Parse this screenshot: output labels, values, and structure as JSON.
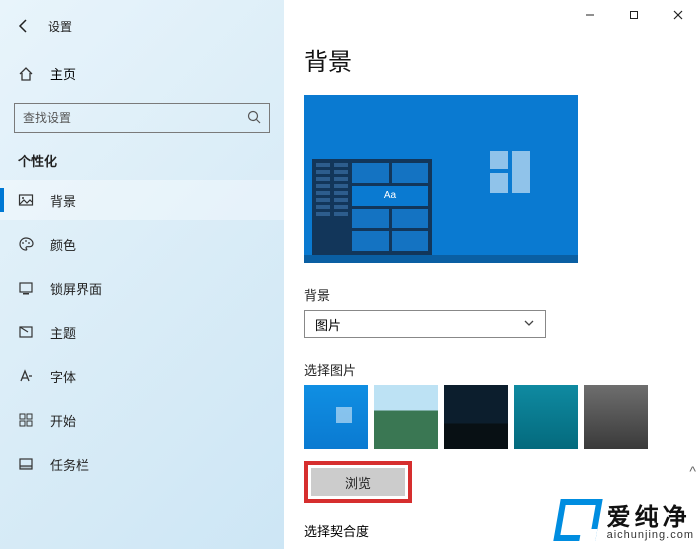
{
  "window": {
    "title": "设置",
    "controls": {
      "minimize": "–",
      "maximize": "□",
      "close": "✕"
    }
  },
  "sidebar": {
    "home_label": "主页",
    "search_placeholder": "查找设置",
    "section": "个性化",
    "items": [
      {
        "label": "背景",
        "icon": "image-icon",
        "selected": true
      },
      {
        "label": "颜色",
        "icon": "palette-icon",
        "selected": false
      },
      {
        "label": "锁屏界面",
        "icon": "lockscreen-icon",
        "selected": false
      },
      {
        "label": "主题",
        "icon": "theme-icon",
        "selected": false
      },
      {
        "label": "字体",
        "icon": "font-icon",
        "selected": false
      },
      {
        "label": "开始",
        "icon": "start-icon",
        "selected": false
      },
      {
        "label": "任务栏",
        "icon": "taskbar-icon",
        "selected": false
      }
    ]
  },
  "main": {
    "heading": "背景",
    "preview_tile_text": "Aa",
    "background_label": "背景",
    "background_value": "图片",
    "choose_image_label": "选择图片",
    "browse_label": "浏览",
    "fit_label": "选择契合度"
  },
  "watermark": {
    "cn": "爱纯净",
    "en": "aichunjing.com"
  }
}
